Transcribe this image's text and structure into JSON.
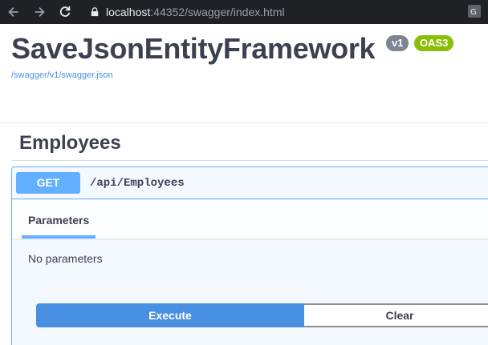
{
  "browser": {
    "url_host": "localhost",
    "url_rest": ":44352/swagger/index.html"
  },
  "info": {
    "title": "SaveJsonEntityFramework",
    "version_badge": "v1",
    "oas_badge": "OAS3",
    "spec_link": "/swagger/v1/swagger.json"
  },
  "section": {
    "title": "Employees"
  },
  "operation": {
    "method": "GET",
    "path": "/api/Employees",
    "params_tab": "Parameters",
    "no_params_text": "No parameters",
    "execute_label": "Execute",
    "clear_label": "Clear"
  },
  "colors": {
    "get_method": "#61affe",
    "execute_button": "#4990e2",
    "oas_badge": "#89bf04",
    "version_badge": "#7d8492"
  }
}
